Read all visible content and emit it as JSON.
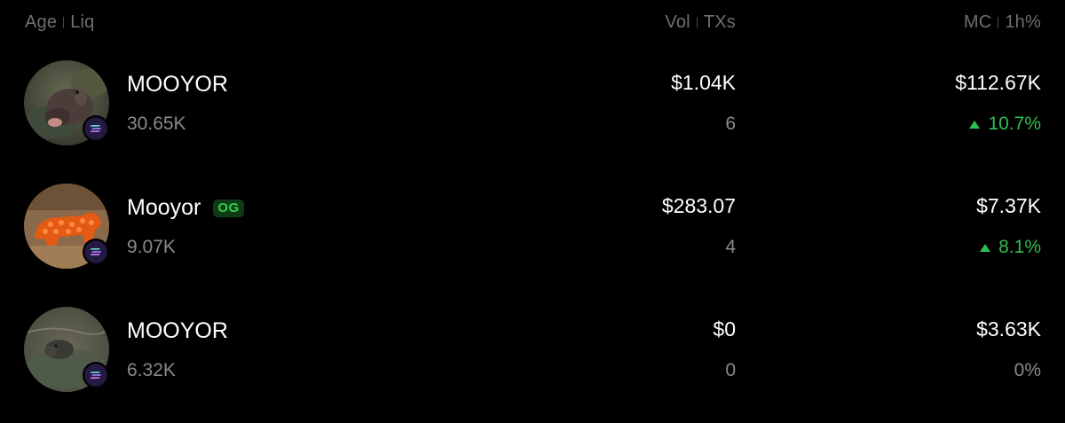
{
  "header": {
    "age_label": "Age",
    "liq_label": "Liq",
    "vol_label": "Vol",
    "txs_label": "TXs",
    "mc_label": "MC",
    "change_label": "1h%"
  },
  "colors": {
    "background": "#000000",
    "positive": "#2fbf4f",
    "muted": "#8a8a8a",
    "og_badge_bg": "#0e3a16",
    "og_badge_text": "#2ed14a"
  },
  "rows": [
    {
      "name": "MOOYOR",
      "badge": "",
      "liquidity": "30.65K",
      "volume": "$1.04K",
      "txs": "6",
      "market_cap": "$112.67K",
      "change_1h": "10.7%",
      "direction": "up",
      "avatar_icon": "pygmy-hippo-photo",
      "chain_icon": "solana-icon"
    },
    {
      "name": "Mooyor",
      "badge": "OG",
      "liquidity": "9.07K",
      "volume": "$283.07",
      "txs": "4",
      "market_cap": "$7.37K",
      "change_1h": "8.1%",
      "direction": "up",
      "avatar_icon": "orange-hippo-photo",
      "chain_icon": "solana-icon"
    },
    {
      "name": "MOOYOR",
      "badge": "",
      "liquidity": "6.32K",
      "volume": "$0",
      "txs": "0",
      "market_cap": "$3.63K",
      "change_1h": "0%",
      "direction": "flat",
      "avatar_icon": "baby-hippo-water-photo",
      "chain_icon": "solana-icon"
    }
  ]
}
